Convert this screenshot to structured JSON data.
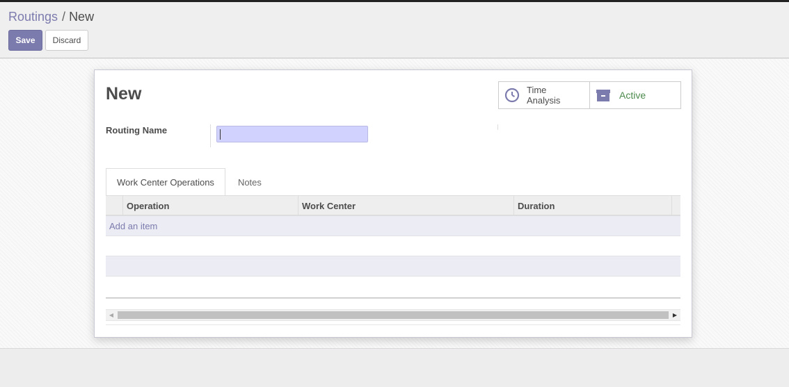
{
  "breadcrumb": {
    "parent": "Routings",
    "separator": "/",
    "current": "New"
  },
  "toolbar": {
    "save_label": "Save",
    "discard_label": "Discard"
  },
  "record": {
    "title": "New"
  },
  "stat_buttons": {
    "time_analysis": {
      "label_line1": "Time",
      "label_line2": "Analysis",
      "icon": "clock-icon"
    },
    "active": {
      "label": "Active",
      "icon": "archive-icon"
    }
  },
  "form": {
    "routing_name_label": "Routing Name",
    "routing_name_value": ""
  },
  "tabs": [
    {
      "label": "Work Center Operations",
      "active": true
    },
    {
      "label": "Notes",
      "active": false
    }
  ],
  "operations_table": {
    "columns": [
      "Operation",
      "Work Center",
      "Duration"
    ],
    "add_item_label": "Add an item",
    "rows": []
  },
  "colors": {
    "accent": "#7c7bad",
    "active_green": "#4c8a4c",
    "input_highlight": "#d2d2ff"
  }
}
